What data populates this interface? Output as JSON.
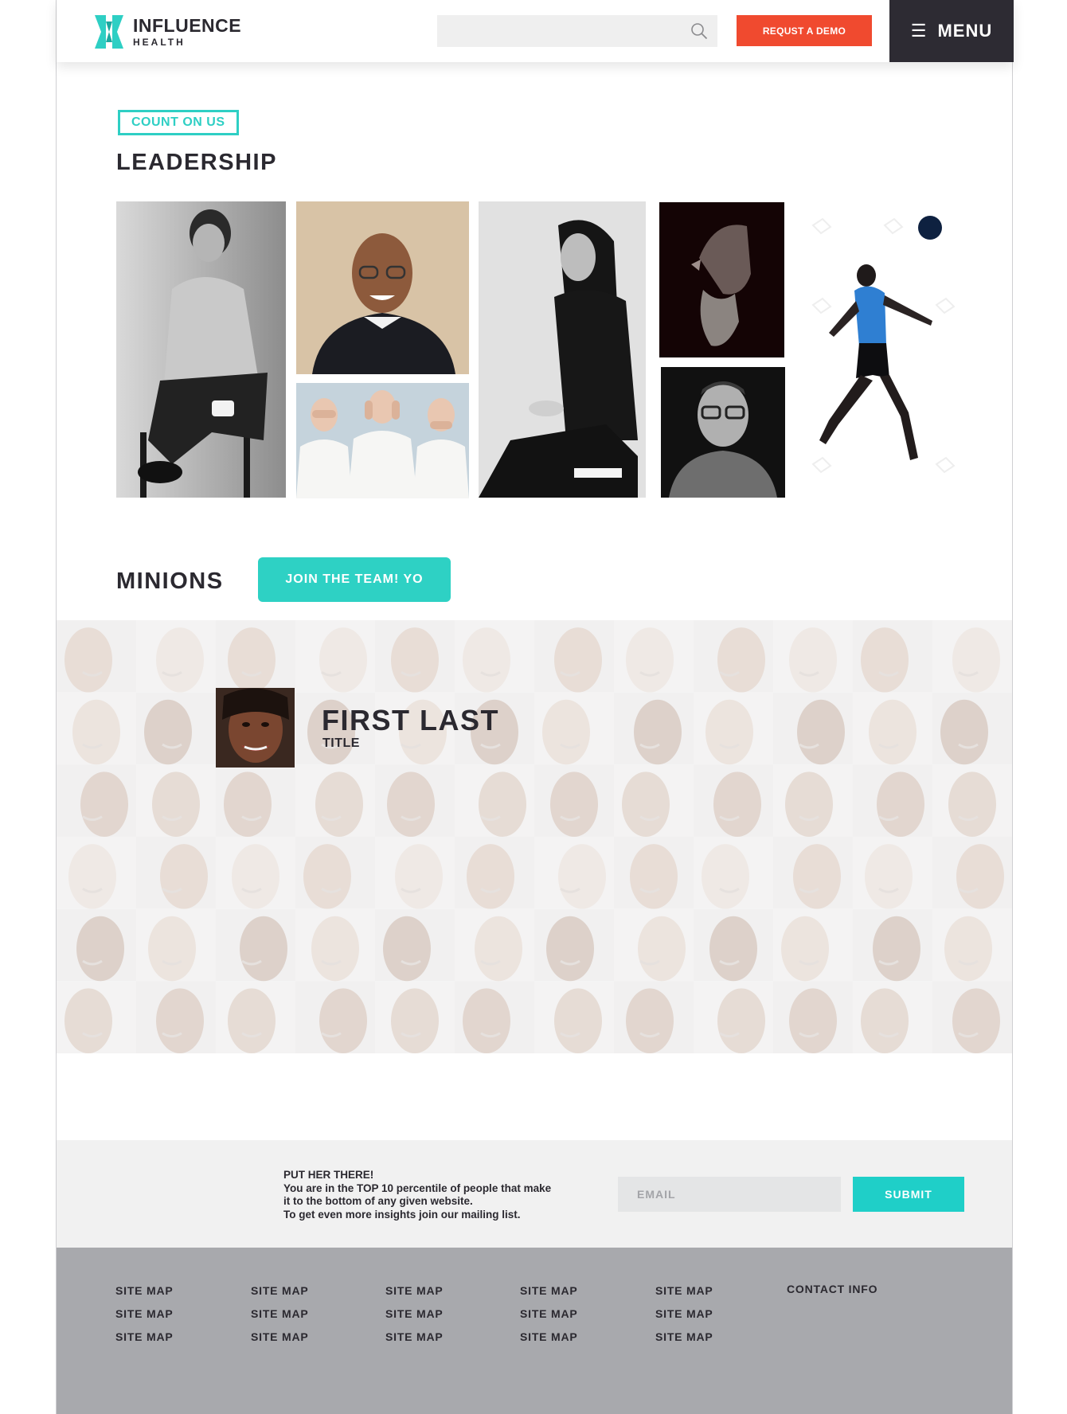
{
  "header": {
    "brand_name": "INFLUENCE",
    "brand_sub": "HEALTH",
    "search_placeholder": "",
    "demo_label": "REQUST A DEMO",
    "menu_icon": "☰",
    "menu_label": "MENU"
  },
  "leadership": {
    "eyebrow": "COUNT ON US",
    "title": "LEADERSHIP"
  },
  "minions": {
    "title": "MINIONS",
    "join_label": "JOIN THE TEAM! YO",
    "featured": {
      "name": "FIRST LAST",
      "title": "TITLE"
    }
  },
  "newsletter": {
    "lines": [
      "PUT HER THERE!",
      "You are in the TOP 10 percentile of people that make",
      "it to the bottom of any given website.",
      "To get even more insights join our mailing list."
    ],
    "email_placeholder": "EMAIL",
    "submit_label": "SUBMIT"
  },
  "footer": {
    "columns": [
      [
        "SITE MAP",
        "SITE MAP",
        "SITE MAP"
      ],
      [
        "SITE MAP",
        "SITE MAP",
        "SITE MAP"
      ],
      [
        "SITE MAP",
        "SITE MAP",
        "SITE MAP"
      ],
      [
        "SITE MAP",
        "SITE MAP",
        "SITE MAP"
      ],
      [
        "SITE MAP",
        "SITE MAP",
        "SITE MAP"
      ]
    ],
    "contact_label": "CONTACT INFO"
  },
  "colors": {
    "accent_teal": "#2ecfc4",
    "demo_orange": "#f04a2f",
    "dark": "#2d2b33",
    "footer_grey": "#a8a9ad"
  }
}
